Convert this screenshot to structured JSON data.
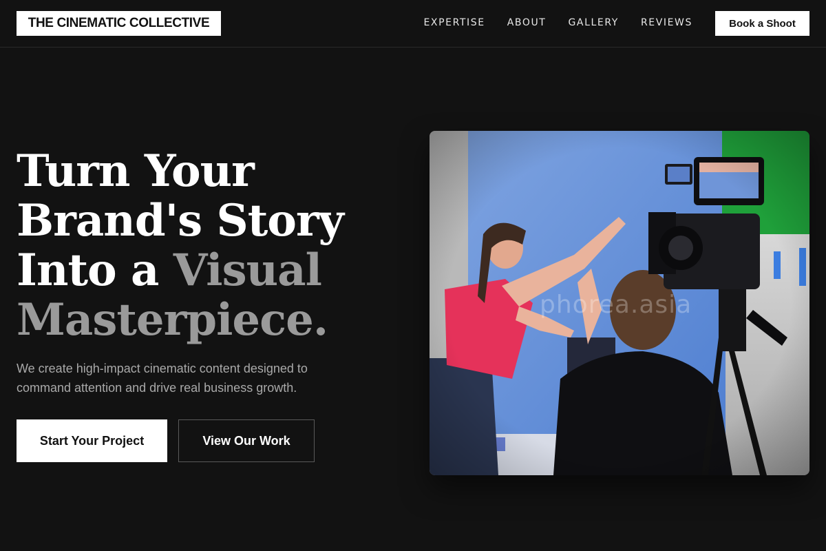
{
  "brand": {
    "name": "THE CINEMATIC COLLECTIVE"
  },
  "nav": {
    "links": [
      {
        "label": "EXPERTISE"
      },
      {
        "label": "ABOUT"
      },
      {
        "label": "GALLERY"
      },
      {
        "label": "REVIEWS"
      }
    ],
    "cta_label": "Book a Shoot"
  },
  "hero": {
    "title_lines": [
      {
        "text": "Turn Your"
      },
      {
        "text": "Brand's Story"
      },
      {
        "text": "Into a ",
        "muted": "Visual"
      },
      {
        "muted": "Masterpiece."
      }
    ],
    "subtitle": "We create high-impact cinematic content designed to command attention and drive real business growth.",
    "primary_button": "Start Your Project",
    "secondary_button": "View Our Work",
    "image": {
      "description_icon": "film-set-photo",
      "watermark": "phorea.asia"
    }
  },
  "colors": {
    "background": "#121212",
    "text": "#ffffff",
    "muted": "#9a9a9a",
    "subtitle": "#a9a9a9"
  }
}
